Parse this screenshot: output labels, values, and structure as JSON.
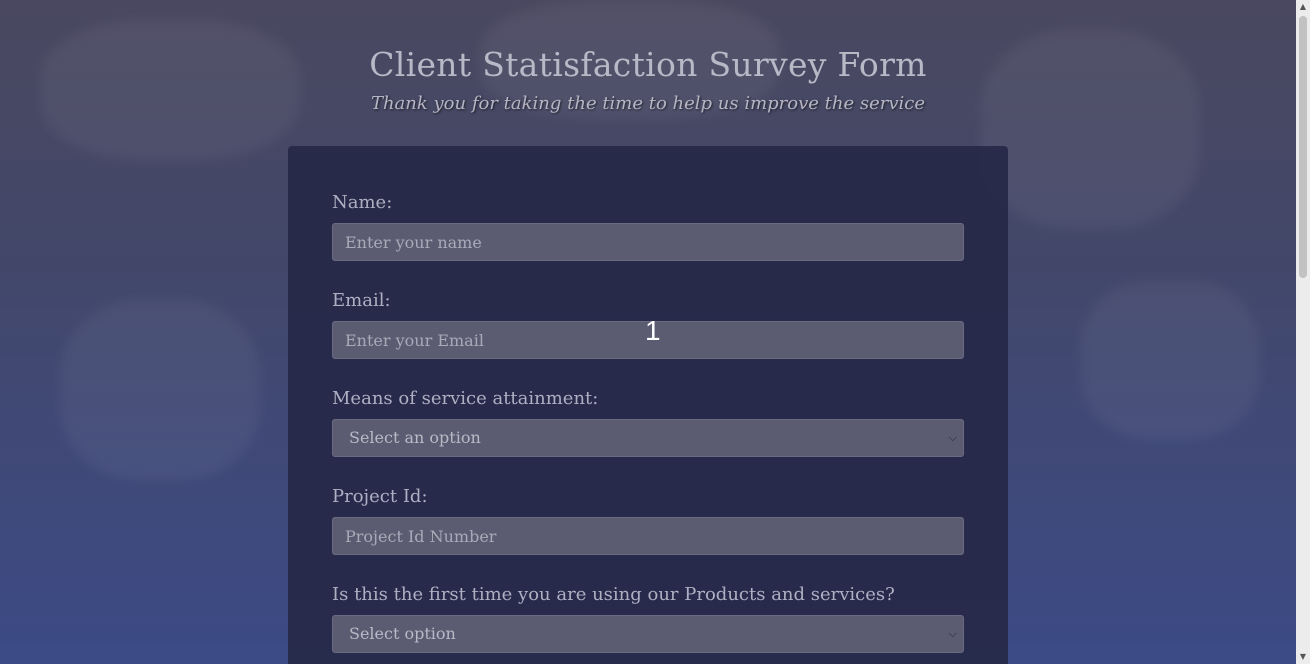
{
  "header": {
    "title": "Client Statisfaction Survey Form",
    "subtitle": "Thank you for taking the time to help us improve the service"
  },
  "form": {
    "name": {
      "label": "Name:",
      "placeholder": "Enter your name",
      "value": ""
    },
    "email": {
      "label": "Email:",
      "placeholder": "Enter your Email",
      "value": ""
    },
    "service_means": {
      "label": "Means of service attainment:",
      "selected": "Select an option"
    },
    "project_id": {
      "label": "Project Id:",
      "placeholder": "Project Id Number",
      "value": ""
    },
    "first_time": {
      "label": "Is this the first time you are using our Products and services?",
      "selected": "Select option"
    }
  },
  "overlay": {
    "marker": "1"
  },
  "icons": {
    "select_chevron": "chevron-down-icon",
    "scroll_up": "arrow-up-icon",
    "scroll_down": "arrow-down-icon"
  }
}
